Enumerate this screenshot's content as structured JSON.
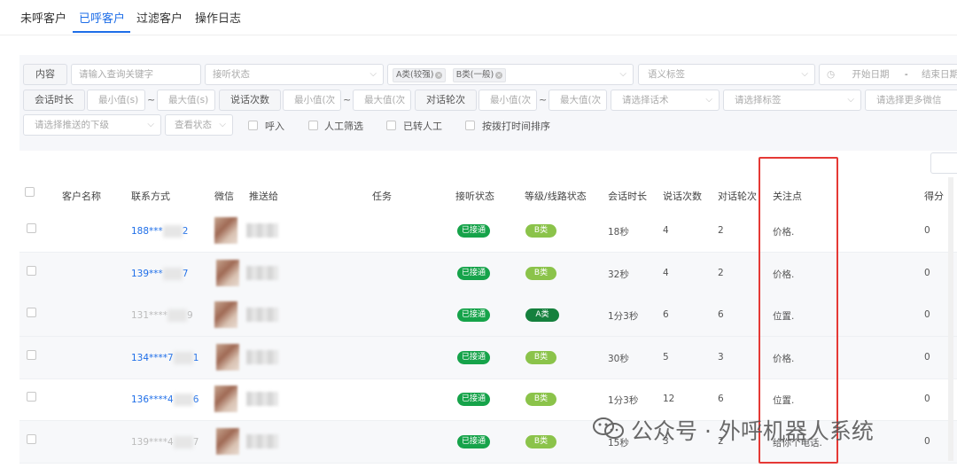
{
  "tabs": [
    {
      "label": "未呼客户"
    },
    {
      "label": "已呼客户"
    },
    {
      "label": "过滤客户"
    },
    {
      "label": "操作日志"
    }
  ],
  "filters": {
    "content_label": "内容",
    "keyword_placeholder": "请输入查询关键字",
    "answer_state_placeholder": "接听状态",
    "grade_tags": [
      "A类(较强)",
      "B类(一般)"
    ],
    "semantic_tag_placeholder": "语义标签",
    "start_date_placeholder": "开始日期",
    "date_sep": "-",
    "end_date_placeholder": "结束日期",
    "duration_label": "会话时长",
    "min_s": "最小值(s)",
    "max_s": "最大值(s)",
    "talk_count_label": "说话次数",
    "min_count": "最小值(次",
    "max_count": "最大值(次",
    "turns_label": "对话轮次",
    "min_turns": "最小值(次",
    "max_turns": "最大值(次",
    "script_placeholder": "请选择话术",
    "tag_placeholder": "请选择标签",
    "wechat_placeholder": "请选择更多微信",
    "push_sub_placeholder": "请选择推送的下级",
    "view_state_placeholder": "查看状态",
    "tilde": "~",
    "checks": [
      "呼入",
      "人工筛选",
      "已转人工",
      "按拨打时间排序"
    ]
  },
  "table": {
    "headers": [
      "客户名称",
      "联系方式",
      "微信",
      "推送给",
      "任务",
      "接听状态",
      "等级/线路状态",
      "会话时长",
      "说话次数",
      "对话轮次",
      "关注点",
      "得分"
    ],
    "rows": [
      {
        "phone_a": "188***",
        "phone_b": "2",
        "answer": "已接通",
        "grade": "B类",
        "duration": "18秒",
        "talks": "4",
        "turns": "2",
        "focus": "价格.",
        "score": "0",
        "dim": false
      },
      {
        "phone_a": "139***",
        "phone_b": "7",
        "answer": "已接通",
        "grade": "B类",
        "duration": "32秒",
        "talks": "4",
        "turns": "2",
        "focus": "价格.",
        "score": "0",
        "dim": false
      },
      {
        "phone_a": "131****",
        "phone_b": "9",
        "answer": "已接通",
        "grade": "A类",
        "duration": "1分3秒",
        "talks": "6",
        "turns": "6",
        "focus": "位置.",
        "score": "0",
        "dim": true
      },
      {
        "phone_a": "134****7",
        "phone_b": "1",
        "answer": "已接通",
        "grade": "B类",
        "duration": "30秒",
        "talks": "5",
        "turns": "3",
        "focus": "价格.",
        "score": "0",
        "dim": false
      },
      {
        "phone_a": "136****4",
        "phone_b": "6",
        "answer": "已接通",
        "grade": "B类",
        "duration": "1分3秒",
        "talks": "12",
        "turns": "6",
        "focus": "位置.",
        "score": "0",
        "dim": false
      },
      {
        "phone_a": "139****4",
        "phone_b": "7",
        "answer": "已接通",
        "grade": "B类",
        "duration": "15秒",
        "talks": "3",
        "turns": "2",
        "focus": "给你个电话.",
        "score": "0",
        "dim": true
      }
    ]
  },
  "watermark": {
    "text": "公众号 · 外呼机器人系统"
  },
  "colors": {
    "accent": "#1e6ee8",
    "connected": "#16a34a",
    "grade_b": "#8bc34a",
    "grade_a": "#15803d",
    "highlight": "#e53935"
  }
}
